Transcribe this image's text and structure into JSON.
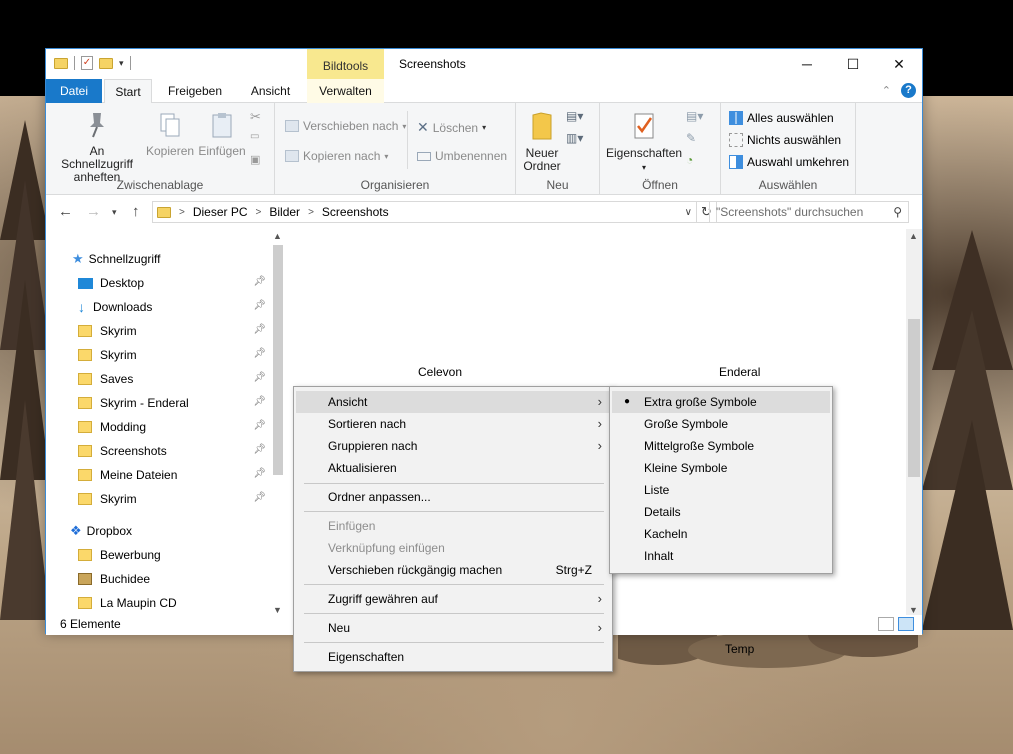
{
  "window": {
    "title": "Screenshots",
    "contextual_tab_group": "Bildtools"
  },
  "tabs": [
    {
      "label": "Datei"
    },
    {
      "label": "Start"
    },
    {
      "label": "Freigeben"
    },
    {
      "label": "Ansicht"
    },
    {
      "label": "Verwalten"
    }
  ],
  "ribbon": {
    "clipboard": {
      "label": "Zwischenablage",
      "pin_line1": "An Schnellzugriff",
      "pin_line2": "anheften",
      "copy": "Kopieren",
      "paste": "Einfügen"
    },
    "organize": {
      "label": "Organisieren",
      "move_to": "Verschieben nach",
      "copy_to": "Kopieren nach",
      "delete": "Löschen",
      "rename": "Umbenennen"
    },
    "new": {
      "label": "Neu",
      "new_folder_line1": "Neuer",
      "new_folder_line2": "Ordner"
    },
    "open": {
      "label": "Öffnen",
      "properties": "Eigenschaften"
    },
    "select": {
      "label": "Auswählen",
      "select_all": "Alles auswählen",
      "select_none": "Nichts auswählen",
      "invert": "Auswahl umkehren"
    }
  },
  "address": {
    "crumbs": [
      "Dieser PC",
      "Bilder",
      "Screenshots"
    ],
    "search_placeholder": "\"Screenshots\" durchsuchen"
  },
  "nav": {
    "quick_access": "Schnellzugriff",
    "items": [
      {
        "label": "Desktop",
        "icon": "desktop-icon",
        "pinned": true
      },
      {
        "label": "Downloads",
        "icon": "download-arrow-icon",
        "pinned": true
      },
      {
        "label": "Skyrim",
        "icon": "folder-icon",
        "pinned": true
      },
      {
        "label": "Skyrim",
        "icon": "folder-icon",
        "pinned": true
      },
      {
        "label": "Saves",
        "icon": "folder-icon",
        "pinned": true
      },
      {
        "label": "Skyrim - Enderal",
        "icon": "folder-icon",
        "pinned": true
      },
      {
        "label": "Modding",
        "icon": "folder-icon",
        "pinned": true
      },
      {
        "label": "Screenshots",
        "icon": "folder-icon",
        "pinned": true
      },
      {
        "label": "Meine Dateien",
        "icon": "folder-icon",
        "pinned": true
      },
      {
        "label": "Skyrim",
        "icon": "folder-icon",
        "pinned": true
      }
    ],
    "dropbox": "Dropbox",
    "dropbox_items": [
      {
        "label": "Bewerbung",
        "icon": "folder-icon"
      },
      {
        "label": "Buchidee",
        "icon": "contacts-folder-icon"
      },
      {
        "label": "La Maupin CD",
        "icon": "folder-icon"
      }
    ]
  },
  "content": {
    "items": [
      "Celevon",
      "Enderal",
      "Temp"
    ]
  },
  "status": {
    "count": "6 Elemente"
  },
  "context_menu": {
    "items": [
      {
        "label": "Ansicht",
        "submenu": true
      },
      {
        "label": "Sortieren nach",
        "submenu": true
      },
      {
        "label": "Gruppieren nach",
        "submenu": true
      },
      {
        "label": "Aktualisieren"
      },
      {
        "label": "Ordner anpassen..."
      },
      {
        "label": "Einfügen",
        "disabled": true
      },
      {
        "label": "Verknüpfung einfügen",
        "disabled": true
      },
      {
        "label": "Verschieben rückgängig machen",
        "shortcut": "Strg+Z"
      },
      {
        "label": "Zugriff gewähren auf",
        "submenu": true
      },
      {
        "label": "Neu",
        "submenu": true
      },
      {
        "label": "Eigenschaften"
      }
    ]
  },
  "view_submenu": {
    "selected": "Extra große Symbole",
    "items": [
      "Extra große Symbole",
      "Große Symbole",
      "Mittelgroße Symbole",
      "Kleine Symbole",
      "Liste",
      "Details",
      "Kacheln",
      "Inhalt"
    ]
  }
}
